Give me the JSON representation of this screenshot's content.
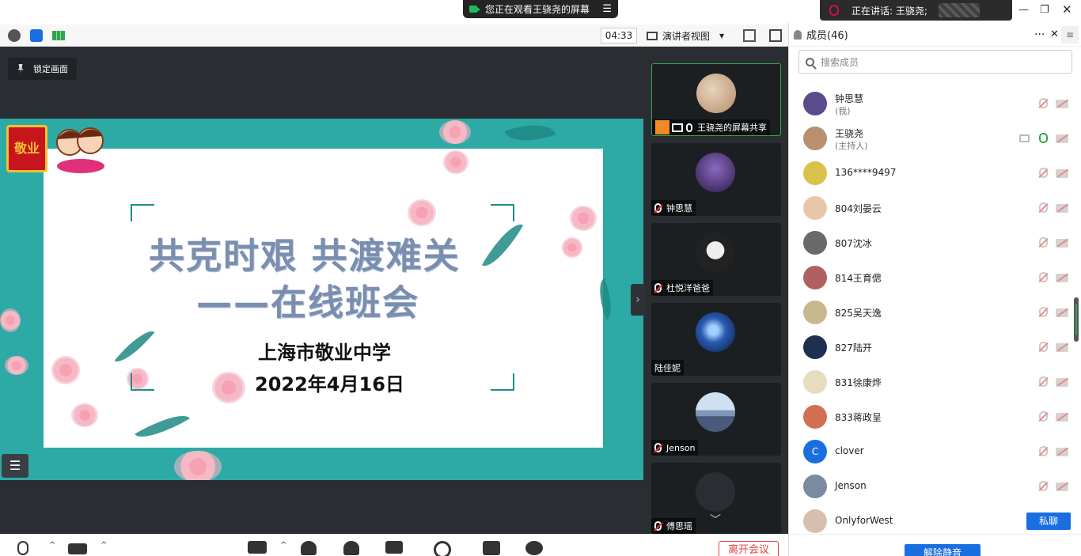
{
  "banner": {
    "viewing": "您正在观看王骁尧的屏幕",
    "menu_glyph": "☰"
  },
  "speaking": {
    "label": "正在讲话: 王骁尧;"
  },
  "toolbar": {
    "timer": "04:33",
    "view_mode": "演讲者视图",
    "view_arrow": "▾"
  },
  "stage": {
    "lock_label": "锁定画面"
  },
  "slide": {
    "title_line1": "共克时艰 共渡难关",
    "title_line2": "——在线班会",
    "school": "上海市敬业中学",
    "date": "2022年4月16日",
    "logo_text": "敬业"
  },
  "thumbnails": [
    {
      "label": "王骁尧的屏幕共享",
      "active": true,
      "avatar_color": "#c9a98a"
    },
    {
      "label": "钟思慧",
      "active": false,
      "avatar_color": "#6a4a9a"
    },
    {
      "label": "杜悦洋爸爸",
      "active": false,
      "avatar_color": "#3a3a3a"
    },
    {
      "label": "陆佳妮",
      "active": false,
      "avatar_color": "#1a4a9a"
    },
    {
      "label": "Jenson",
      "active": false,
      "avatar_color": "#8aa0c0"
    },
    {
      "label": "傅思瑶",
      "active": false,
      "avatar_color": "#2a2d31"
    }
  ],
  "panel": {
    "title": "成员(46)",
    "more": "···",
    "close": "✕",
    "search_placeholder": "搜索成员",
    "unmute_all": "解除静音",
    "chat_label": "私聊"
  },
  "members": [
    {
      "name": "钟思慧",
      "sub": "(我)",
      "color": "#5a4b8a"
    },
    {
      "name": "王骁尧",
      "sub": "(主持人)",
      "color": "#b89070"
    },
    {
      "name": "136****9497",
      "sub": "",
      "color": "#d8c24a"
    },
    {
      "name": "804刘晏云",
      "sub": "",
      "color": "#e7c7a8"
    },
    {
      "name": "807沈冰",
      "sub": "",
      "color": "#6a6a6a"
    },
    {
      "name": "814王育偲",
      "sub": "",
      "color": "#b06060"
    },
    {
      "name": "825吴天逸",
      "sub": "",
      "color": "#c8b890"
    },
    {
      "name": "827陆开",
      "sub": "",
      "color": "#1e3050"
    },
    {
      "name": "831徐康烨",
      "sub": "",
      "color": "#e8dcc0"
    },
    {
      "name": "833蒋政呈",
      "sub": "",
      "color": "#d07050"
    },
    {
      "name": "clover",
      "sub": "",
      "color": "#1a6fe0",
      "initial": "C"
    },
    {
      "name": "Jenson",
      "sub": "",
      "color": "#7a8aa0"
    },
    {
      "name": "OnlyforWest",
      "sub": "",
      "color": "#d8c0b0"
    }
  ],
  "bottom": {
    "leave_label": "离开会议"
  },
  "colors": {
    "accent": "#1a6fe0",
    "stage_bg": "#2a2d31",
    "slide_teal": "#2eaaa6",
    "leave": "#e04444"
  }
}
